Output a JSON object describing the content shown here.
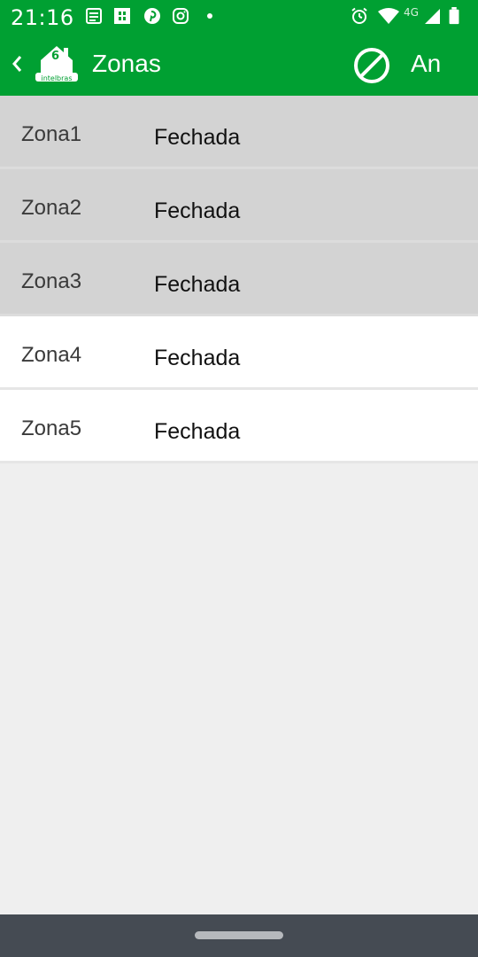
{
  "status_bar": {
    "time": "21:16",
    "icons": [
      "news-icon",
      "grid-app-icon",
      "pinterest-icon",
      "instagram-icon",
      "alarm-icon",
      "wifi-icon",
      "signal-4g-icon",
      "battery-icon"
    ],
    "network": "4G"
  },
  "app_bar": {
    "title": "Zonas",
    "action_label": "An",
    "logo_number": "6",
    "logo_text": "intelbras",
    "color": "#00a032"
  },
  "zones": [
    {
      "name": "Zona1",
      "status": "Fechada",
      "highlighted": true
    },
    {
      "name": "Zona2",
      "status": "Fechada",
      "highlighted": true
    },
    {
      "name": "Zona3",
      "status": "Fechada",
      "highlighted": true
    },
    {
      "name": "Zona4",
      "status": "Fechada",
      "highlighted": false
    },
    {
      "name": "Zona5",
      "status": "Fechada",
      "highlighted": false
    }
  ],
  "colors": {
    "highlighted_row": "#d3d3d3",
    "normal_row": "#ffffff",
    "background": "#efefef",
    "nav_bar": "#454b53"
  }
}
